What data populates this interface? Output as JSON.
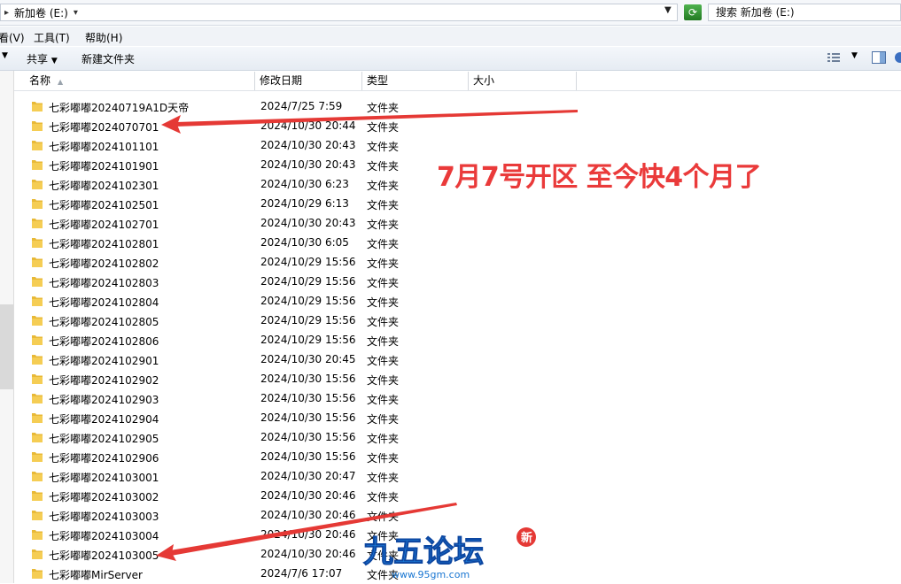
{
  "address": {
    "path_root": "新加卷 (E:)",
    "search_text": "搜索 新加卷 (E:)"
  },
  "menu": {
    "view": "看(V)",
    "tools": "工具(T)",
    "help": "帮助(H)"
  },
  "toolbar": {
    "share": "共享",
    "new_folder": "新建文件夹"
  },
  "columns": {
    "name": "名称",
    "date": "修改日期",
    "type": "类型",
    "size": "大小"
  },
  "files": [
    {
      "name": "七彩嘟嘟20240719A1D天帝",
      "date": "2024/7/25 7:59",
      "type": "文件夹"
    },
    {
      "name": "七彩嘟嘟2024070701",
      "date": "2024/10/30 20:44",
      "type": "文件夹"
    },
    {
      "name": "七彩嘟嘟2024101101",
      "date": "2024/10/30 20:43",
      "type": "文件夹"
    },
    {
      "name": "七彩嘟嘟2024101901",
      "date": "2024/10/30 20:43",
      "type": "文件夹"
    },
    {
      "name": "七彩嘟嘟2024102301",
      "date": "2024/10/30 6:23",
      "type": "文件夹"
    },
    {
      "name": "七彩嘟嘟2024102501",
      "date": "2024/10/29 6:13",
      "type": "文件夹"
    },
    {
      "name": "七彩嘟嘟2024102701",
      "date": "2024/10/30 20:43",
      "type": "文件夹"
    },
    {
      "name": "七彩嘟嘟2024102801",
      "date": "2024/10/30 6:05",
      "type": "文件夹"
    },
    {
      "name": "七彩嘟嘟2024102802",
      "date": "2024/10/29 15:56",
      "type": "文件夹"
    },
    {
      "name": "七彩嘟嘟2024102803",
      "date": "2024/10/29 15:56",
      "type": "文件夹"
    },
    {
      "name": "七彩嘟嘟2024102804",
      "date": "2024/10/29 15:56",
      "type": "文件夹"
    },
    {
      "name": "七彩嘟嘟2024102805",
      "date": "2024/10/29 15:56",
      "type": "文件夹"
    },
    {
      "name": "七彩嘟嘟2024102806",
      "date": "2024/10/29 15:56",
      "type": "文件夹"
    },
    {
      "name": "七彩嘟嘟2024102901",
      "date": "2024/10/30 20:45",
      "type": "文件夹"
    },
    {
      "name": "七彩嘟嘟2024102902",
      "date": "2024/10/30 15:56",
      "type": "文件夹"
    },
    {
      "name": "七彩嘟嘟2024102903",
      "date": "2024/10/30 15:56",
      "type": "文件夹"
    },
    {
      "name": "七彩嘟嘟2024102904",
      "date": "2024/10/30 15:56",
      "type": "文件夹"
    },
    {
      "name": "七彩嘟嘟2024102905",
      "date": "2024/10/30 15:56",
      "type": "文件夹"
    },
    {
      "name": "七彩嘟嘟2024102906",
      "date": "2024/10/30 15:56",
      "type": "文件夹"
    },
    {
      "name": "七彩嘟嘟2024103001",
      "date": "2024/10/30 20:47",
      "type": "文件夹"
    },
    {
      "name": "七彩嘟嘟2024103002",
      "date": "2024/10/30 20:46",
      "type": "文件夹"
    },
    {
      "name": "七彩嘟嘟2024103003",
      "date": "2024/10/30 20:46",
      "type": "文件夹"
    },
    {
      "name": "七彩嘟嘟2024103004",
      "date": "2024/10/30 20:46",
      "type": "文件夹"
    },
    {
      "name": "七彩嘟嘟2024103005",
      "date": "2024/10/30 20:46",
      "type": "文件夹"
    },
    {
      "name": "七彩嘟嘟MirServer",
      "date": "2024/7/6 17:07",
      "type": "文件夹"
    }
  ],
  "annotation": {
    "text": "7月7号开区 至今快4个月了",
    "color": "#ea3a3a"
  },
  "watermark": {
    "brand": "九五论坛",
    "url": "www.95gm.com",
    "badge": "新"
  },
  "colors": {
    "folder": "#e8b937",
    "arrow": "#e53935"
  }
}
